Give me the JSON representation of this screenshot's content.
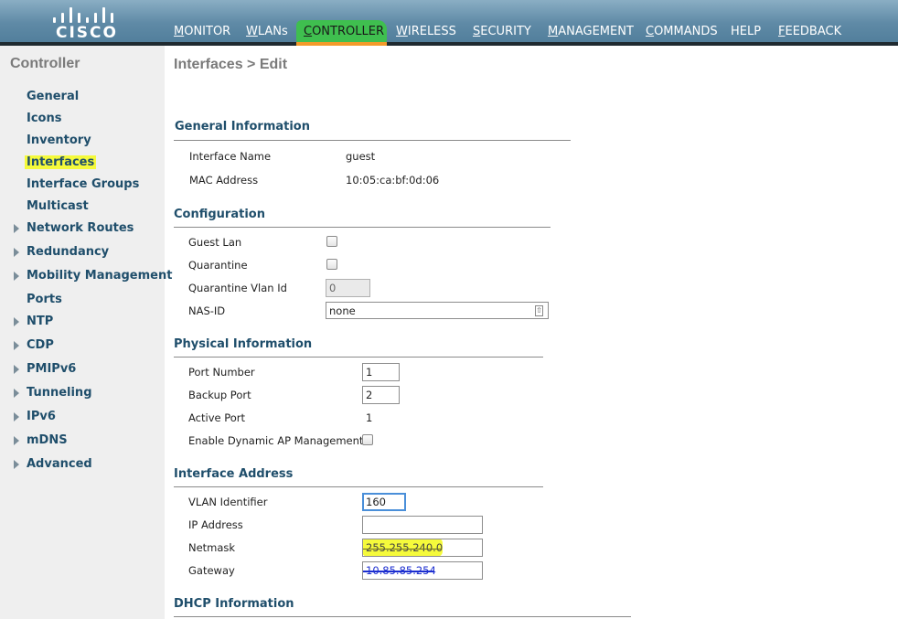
{
  "header": {
    "logo_text": "CISCO",
    "nav": [
      {
        "label": "MONITOR",
        "key": "M",
        "rest": "ONITOR"
      },
      {
        "label": "WLANs",
        "key": "W",
        "rest": "LANs"
      },
      {
        "label": "CONTROLLER",
        "key": "C",
        "rest": "ONTROLLER"
      },
      {
        "label": "WIRELESS",
        "key": "W",
        "rest": "IRELESS"
      },
      {
        "label": "SECURITY",
        "key": "S",
        "rest": "ECURITY"
      },
      {
        "label": "MANAGEMENT",
        "key": "M",
        "rest": "ANAGEMENT"
      },
      {
        "label": "COMMANDS",
        "key": "C",
        "rest": "OMMANDS"
      },
      {
        "label": "HELP",
        "key": "",
        "rest": "HELP"
      },
      {
        "label": "FEEDBACK",
        "key": "F",
        "rest": "EEDBACK"
      }
    ],
    "active_nav": "CONTROLLER",
    "colors": {
      "active_highlight": "#3fbf4f",
      "active_underline": "#f39a2a"
    }
  },
  "sidebar": {
    "title": "Controller",
    "items": [
      {
        "label": "General",
        "expandable": false
      },
      {
        "label": "Icons",
        "expandable": false
      },
      {
        "label": "Inventory",
        "expandable": false
      },
      {
        "label": "Interfaces",
        "expandable": false,
        "highlighted": true
      },
      {
        "label": "Interface Groups",
        "expandable": false
      },
      {
        "label": "Multicast",
        "expandable": false
      },
      {
        "label": "Network Routes",
        "expandable": true
      },
      {
        "label": "Redundancy",
        "expandable": true
      },
      {
        "label": "Mobility Management",
        "expandable": true
      },
      {
        "label": "Ports",
        "expandable": false
      },
      {
        "label": "NTP",
        "expandable": true
      },
      {
        "label": "CDP",
        "expandable": true
      },
      {
        "label": "PMIPv6",
        "expandable": true
      },
      {
        "label": "Tunneling",
        "expandable": true
      },
      {
        "label": "IPv6",
        "expandable": true
      },
      {
        "label": "mDNS",
        "expandable": true
      },
      {
        "label": "Advanced",
        "expandable": true
      }
    ]
  },
  "main": {
    "page_title": "Interfaces > Edit",
    "general": {
      "title": "General Information",
      "interface_name_label": "Interface Name",
      "interface_name": "guest",
      "mac_label": "MAC Address",
      "mac": "10:05:ca:bf:0d:06"
    },
    "configuration": {
      "title": "Configuration",
      "guest_lan_label": "Guest Lan",
      "guest_lan_checked": false,
      "quarantine_label": "Quarantine",
      "quarantine_checked": false,
      "quarantine_vlan_label": "Quarantine Vlan Id",
      "quarantine_vlan_value": "0",
      "nas_id_label": "NAS-ID",
      "nas_id_value": "none"
    },
    "physical": {
      "title": "Physical Information",
      "port_number_label": "Port Number",
      "port_number_value": "1",
      "backup_port_label": "Backup Port",
      "backup_port_value": "2",
      "active_port_label": "Active Port",
      "active_port_value": "1",
      "dynamic_ap_label": "Enable Dynamic AP Management",
      "dynamic_ap_checked": false
    },
    "address": {
      "title": "Interface Address",
      "vlan_label": "VLAN Identifier",
      "vlan_value": "160",
      "ip_label": "IP Address",
      "ip_value": "",
      "netmask_label": "Netmask",
      "netmask_value": "255.255.240.0",
      "gateway_label": "Gateway",
      "gateway_value": "10.85.85.254"
    },
    "dhcp": {
      "title": "DHCP Information"
    }
  }
}
